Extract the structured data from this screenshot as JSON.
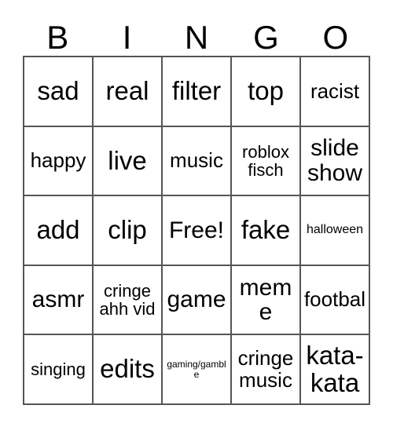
{
  "card": {
    "headers": [
      "B",
      "I",
      "N",
      "G",
      "O"
    ],
    "rows": [
      [
        {
          "text": "sad",
          "size": "fs-xl"
        },
        {
          "text": "real",
          "size": "fs-xl"
        },
        {
          "text": "filter",
          "size": "fs-xl"
        },
        {
          "text": "top",
          "size": "fs-xl"
        },
        {
          "text": "racist",
          "size": "fs-md"
        }
      ],
      [
        {
          "text": "happy",
          "size": "fs-md"
        },
        {
          "text": "live",
          "size": "fs-xl"
        },
        {
          "text": "music",
          "size": "fs-md"
        },
        {
          "text": "roblox fisch",
          "size": "fs-sm"
        },
        {
          "text": "slide show",
          "size": "fs-lg"
        }
      ],
      [
        {
          "text": "add",
          "size": "fs-xl"
        },
        {
          "text": "clip",
          "size": "fs-xl"
        },
        {
          "text": "Free!",
          "size": "fs-lg"
        },
        {
          "text": "fake",
          "size": "fs-xl"
        },
        {
          "text": "halloween",
          "size": "fs-xs"
        }
      ],
      [
        {
          "text": "asmr",
          "size": "fs-lg"
        },
        {
          "text": "cringe ahh vid",
          "size": "fs-sm"
        },
        {
          "text": "game",
          "size": "fs-lg"
        },
        {
          "text": "meme",
          "size": "fs-lg"
        },
        {
          "text": "footbal",
          "size": "fs-md"
        }
      ],
      [
        {
          "text": "singing",
          "size": "fs-sm"
        },
        {
          "text": "edits",
          "size": "fs-xl"
        },
        {
          "text": "gaming/gamble",
          "size": "fs-xxs"
        },
        {
          "text": "cringe music",
          "size": "fs-md"
        },
        {
          "text": "kata-kata",
          "size": "fs-xl"
        }
      ]
    ]
  },
  "colors": {
    "border": "#555555",
    "cell_background": "#ffffff",
    "text": "#000000",
    "page_background": "#ffffff"
  }
}
